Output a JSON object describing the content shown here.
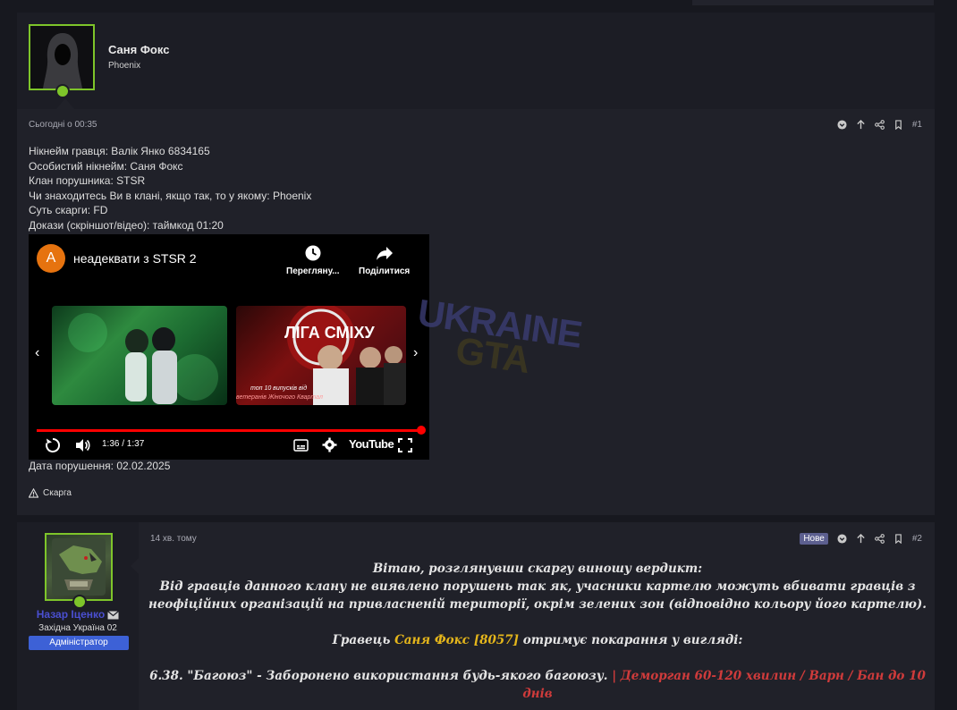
{
  "post1": {
    "author": "Саня Фокс",
    "group": "Phoenix",
    "date": "Сьогодні о 00:35",
    "number": "#1",
    "lines": [
      "Нікнейм гравця: Валік Янко 6834165",
      "Особистий нікнейм: Саня Фокс",
      "Клан порушника: STSR",
      "Чи знаходитесь Ви в клані, якщо так, то у якому: Phoenix",
      "Суть скарги: FD",
      "Докази (скріншот/відео): таймкод 01:20"
    ],
    "video": {
      "channel_letter": "A",
      "title": "неадеквати з STSR 2",
      "watch_label": "Перегляну...",
      "share_label": "Поділитися",
      "time": "1:36 / 1:37",
      "brand": "YouTube",
      "thumb2_title": "ЛІГА СМІХУ",
      "thumb2_caption1": "топ 10 випусків від",
      "thumb2_caption2": "ветеранів Жіночого Квартал",
      "progress": 0.99
    },
    "watermark_line1": "UKRAINE",
    "watermark_line2": "GTA",
    "violation_date": "Дата порушення: 02.02.2025",
    "report_label": "Скарга"
  },
  "post2": {
    "author": "Назар Іценко",
    "group": "Західна Україна 02",
    "role_badge": "Адміністратор",
    "date": "14 хв. тому",
    "new_badge": "Нове",
    "number": "#2",
    "greeting": "Вітаю, розглянувши скаргу виношу вердикт:",
    "verdict": "Від гравців данного клану не виявлено порушень так як, учасники картелю можуть вбивати гравців з неофіційних організацій на привласненій території, окрім зелених зон (відповідно кольору його картелю).",
    "punish_prefix": "Гравець",
    "punish_player": "Саня Фокс [8057]",
    "punish_suffix": "отримує покарання у вигляді:",
    "rule": "6.38. \"Багоюз\" - Заборонено використання будь-якого багоюзу.",
    "penalty": "| Деморган 60-120 хвилин / Варн / Бан до 10 днів"
  },
  "colors": {
    "accent_green": "#7ec52a",
    "admin_badge": "#3d61d6",
    "author_link": "#4a4fd1",
    "player_highlight": "#e5b61b",
    "penalty_red": "#cf3b3b",
    "progress_red": "#ff0000"
  },
  "icons": [
    "chevron-down-icon",
    "arrow-up-icon",
    "share-icon",
    "bookmark-icon",
    "warning-icon",
    "mail-icon",
    "clock-icon",
    "share-arrow-icon",
    "replay-icon",
    "volume-icon",
    "subtitles-icon",
    "settings-icon",
    "fullscreen-icon"
  ]
}
